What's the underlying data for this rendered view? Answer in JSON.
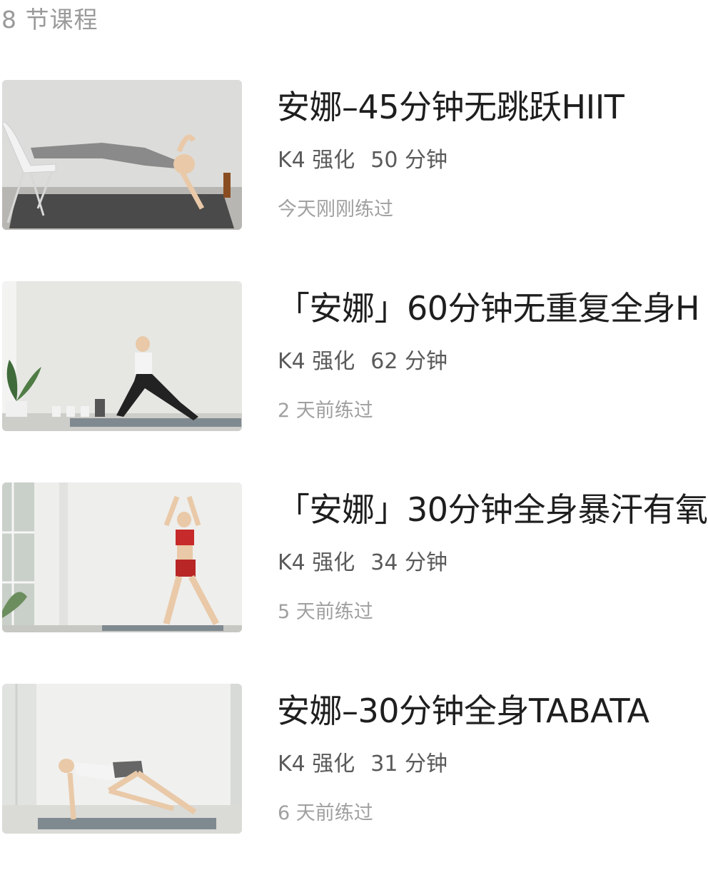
{
  "header": {
    "lesson_count": "8 节课程"
  },
  "courses": [
    {
      "title": "安娜–45分钟无跳跃HIIT",
      "level": "K4 强化",
      "duration": "50 分钟",
      "last_practiced": "今天刚刚练过",
      "thumbnail": "woman-side-plank-on-chair-photo"
    },
    {
      "title": "「安娜」60分钟无重复全身H",
      "level": "K4 强化",
      "duration": "62 分钟",
      "last_practiced": "2 天前练过",
      "thumbnail": "woman-side-lunge-photo"
    },
    {
      "title": "「安娜」30分钟全身暴汗有氧",
      "level": "K4 强化",
      "duration": "34 分钟",
      "last_practiced": "5 天前练过",
      "thumbnail": "woman-jumping-jack-red-outfit-photo"
    },
    {
      "title": "安娜–30分钟全身TABATA",
      "level": "K4 强化",
      "duration": "31 分钟",
      "last_practiced": "6 天前练过",
      "thumbnail": "woman-mountain-climber-photo"
    }
  ]
}
